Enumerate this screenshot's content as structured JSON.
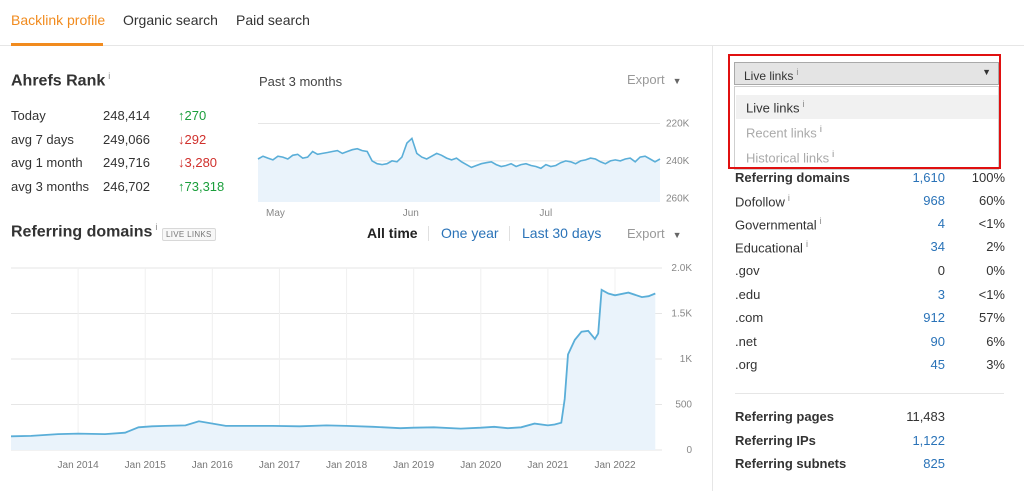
{
  "tabs": [
    {
      "label": "Backlink profile",
      "active": true
    },
    {
      "label": "Organic search",
      "active": false
    },
    {
      "label": "Paid search",
      "active": false
    }
  ],
  "ahrefs_rank": {
    "title": "Ahrefs Rank",
    "info": "i",
    "rows": [
      {
        "label": "Today",
        "value": "248,414",
        "delta": "↑270",
        "dir": "up"
      },
      {
        "label": "avg 7 days",
        "value": "249,066",
        "delta": "↓292",
        "dir": "down"
      },
      {
        "label": "avg 1 month",
        "value": "249,716",
        "delta": "↓3,280",
        "dir": "down"
      },
      {
        "label": "avg 3 months",
        "value": "246,702",
        "delta": "↑73,318",
        "dir": "up"
      }
    ],
    "period": "Past 3 months",
    "export": "Export"
  },
  "referring_domains_header": {
    "title": "Referring domains",
    "info": "i",
    "badge": "LIVE LINKS",
    "ranges": [
      "All time",
      "One year",
      "Last 30 days"
    ],
    "active_range": "All time",
    "export": "Export"
  },
  "chart_data": [
    {
      "type": "area",
      "title": "",
      "x_tick_labels": [
        "May",
        "Jun",
        "Jul"
      ],
      "y_tick_labels": [
        "220K",
        "240K",
        "260K"
      ],
      "y_reversed": true,
      "ylim": [
        216000,
        262000
      ],
      "series": [
        {
          "values": [
            239000,
            237500,
            238500,
            239500,
            237500,
            238000,
            239000,
            237000,
            236500,
            238500,
            238000,
            235000,
            236500,
            236000,
            235500,
            235000,
            234500,
            236000,
            235000,
            234000,
            233500,
            234500,
            235000,
            240000,
            241500,
            242000,
            241500,
            240000,
            240500,
            238000,
            230500,
            228000,
            236000,
            238000,
            239000,
            237500,
            236000,
            237000,
            238500,
            239500,
            238500,
            240500,
            242000,
            243500,
            242500,
            241500,
            241000,
            240500,
            242000,
            243000,
            242500,
            241500,
            243000,
            242000,
            241500,
            242500,
            243000,
            244000,
            242000,
            243000,
            242500,
            241000,
            240000,
            240500,
            241500,
            240000,
            239500,
            238500,
            239000,
            240500,
            241500,
            240000,
            239500,
            240000,
            239000,
            238500,
            240500,
            238000,
            237500,
            239000,
            240500,
            239000
          ]
        }
      ]
    },
    {
      "type": "area",
      "title": "",
      "x_tick_labels": [
        "Jan 2014",
        "Jan 2015",
        "Jan 2016",
        "Jan 2017",
        "Jan 2018",
        "Jan 2019",
        "Jan 2020",
        "Jan 2021",
        "Jan 2022"
      ],
      "y_tick_labels": [
        "0",
        "500",
        "1K",
        "1.5K",
        "2.0K"
      ],
      "ylim": [
        0,
        2000
      ],
      "series": [
        {
          "x": [
            2013.0,
            2013.3,
            2013.7,
            2014.0,
            2014.4,
            2014.7,
            2014.9,
            2015.1,
            2015.3,
            2015.6,
            2015.8,
            2016.2,
            2016.5,
            2016.9,
            2017.3,
            2017.7,
            2018.0,
            2018.4,
            2018.8,
            2019.0,
            2019.3,
            2019.7,
            2020.0,
            2020.2,
            2020.4,
            2020.6,
            2020.8,
            2021.0,
            2021.1,
            2021.2,
            2021.25,
            2021.3,
            2021.4,
            2021.5,
            2021.6,
            2021.7,
            2021.75,
            2021.8,
            2021.9,
            2022.0,
            2022.2,
            2022.4,
            2022.5,
            2022.6
          ],
          "values": [
            150,
            155,
            175,
            180,
            175,
            190,
            250,
            260,
            265,
            270,
            315,
            265,
            265,
            265,
            260,
            270,
            265,
            255,
            240,
            245,
            250,
            235,
            245,
            255,
            240,
            250,
            290,
            270,
            280,
            300,
            560,
            1050,
            1210,
            1300,
            1310,
            1220,
            1280,
            1760,
            1720,
            1700,
            1730,
            1680,
            1690,
            1720
          ]
        }
      ]
    }
  ],
  "right_panel": {
    "dropdown": {
      "selected": "Live links",
      "info": "i",
      "options": [
        {
          "label": "Live links",
          "enabled": true
        },
        {
          "label": "Recent links",
          "enabled": false
        },
        {
          "label": "Historical links",
          "enabled": false
        }
      ]
    },
    "stats": [
      {
        "label": "Referring domains",
        "value": "1,610",
        "pct": "100%",
        "info": true
      },
      {
        "label": "Dofollow",
        "value": "968",
        "pct": "60%",
        "info": true
      },
      {
        "label": "Governmental",
        "value": "4",
        "pct": "<1%",
        "info": true
      },
      {
        "label": "Educational",
        "value": "34",
        "pct": "2%",
        "info": true
      },
      {
        "label": ".gov",
        "value": "0",
        "pct": "0%",
        "info": false
      },
      {
        "label": ".edu",
        "value": "3",
        "pct": "<1%",
        "info": false
      },
      {
        "label": ".com",
        "value": "912",
        "pct": "57%",
        "info": false
      },
      {
        "label": ".net",
        "value": "90",
        "pct": "6%",
        "info": false
      },
      {
        "label": ".org",
        "value": "45",
        "pct": "3%",
        "info": false
      }
    ],
    "summary": [
      {
        "label": "Referring pages",
        "value": "11,483",
        "link": false
      },
      {
        "label": "Referring IPs",
        "value": "1,122",
        "link": true
      },
      {
        "label": "Referring subnets",
        "value": "825",
        "link": true
      }
    ]
  }
}
